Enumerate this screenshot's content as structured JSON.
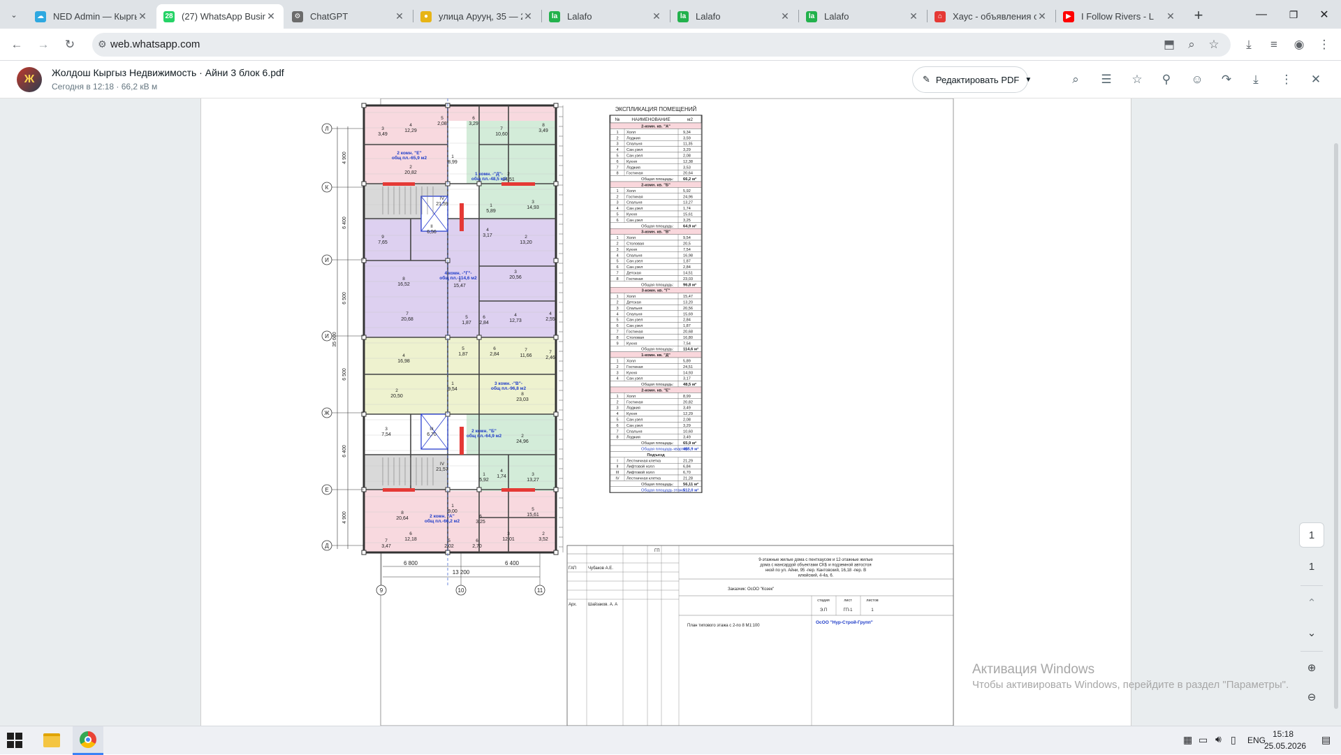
{
  "browser": {
    "tabs": [
      {
        "title": "NED Admin — Кыргы",
        "color": "#2ea8e0",
        "glyph": "☁",
        "active": false
      },
      {
        "title": "(27) WhatsApp Busin",
        "color": "#25d366",
        "glyph": "28",
        "active": true
      },
      {
        "title": "ChatGPT",
        "color": "#6b6b6b",
        "glyph": "⚙",
        "active": false
      },
      {
        "title": "улица Арууң, 35 — 2",
        "color": "#e7b416",
        "glyph": "●",
        "active": false
      },
      {
        "title": "Lalafo",
        "color": "#22b14c",
        "glyph": "la",
        "active": false
      },
      {
        "title": "Lalafo",
        "color": "#22b14c",
        "glyph": "la",
        "active": false
      },
      {
        "title": "Lalafo",
        "color": "#22b14c",
        "glyph": "la",
        "active": false
      },
      {
        "title": "Хаус - объявления о",
        "color": "#e53935",
        "glyph": "⌂",
        "active": false
      },
      {
        "title": "I Follow Rivers - L",
        "color": "#ff0000",
        "glyph": "▶",
        "active": false
      }
    ],
    "url": "web.whatsapp.com"
  },
  "document": {
    "name": "Жолдош Кыргыз Недвижимость · Айни 3 блок 6.pdf",
    "meta": "Сегодня в 12:18 · 66,2 кВ м",
    "edit_label": "Редактировать PDF"
  },
  "plan": {
    "axes_rows": [
      "Л",
      "К",
      "И",
      "И",
      "Ж",
      "Е",
      "Д"
    ],
    "axes_cols": [
      "9",
      "10",
      "11"
    ],
    "dims_left": [
      "4 900",
      "6 400",
      "6 500",
      "6 500",
      "6 400",
      "4 900"
    ],
    "dim_total": "35 600",
    "dims_bottom": [
      "6 800",
      "6 400"
    ],
    "dim_bottom_total": "13 200",
    "labels": [
      "2 комн. \"Е\" общ пл.-65,9 м2",
      "1 комн. -\"Д\"- общ пл.-48,5 м2",
      "4 комн. -\"Г\"- общ пл.-114,6 м2",
      "3 комн. -\"В\"- общ пл.-96,8 м2",
      "2 комн. \"Б\" общ пл.-64,9 м2",
      "2 комн. \"А\" общ пл.-66,2 м2"
    ]
  },
  "explication": {
    "title": "ЭКСПЛИКАЦИЯ ПОМЕЩЕНИЙ",
    "headers": [
      "№",
      "НАИМЕНОВАНИЕ",
      "м2"
    ],
    "groups": [
      {
        "name": "2-комн. кв. \"А\"",
        "rows": [
          [
            "1",
            "Холл",
            "9,34"
          ],
          [
            "2",
            "Лоджия",
            "3,59"
          ],
          [
            "3",
            "Спальня",
            "11,35"
          ],
          [
            "4",
            "Сан.узел",
            "3,29"
          ],
          [
            "5",
            "Сан.узел",
            "2,08"
          ],
          [
            "6",
            "Кухня",
            "12,38"
          ],
          [
            "7",
            "Лоджия",
            "3,53"
          ],
          [
            "8",
            "Гостиная",
            "20,64"
          ]
        ],
        "total": "66,2 м²"
      },
      {
        "name": "2-комн. кв. \"Б\"",
        "rows": [
          [
            "1",
            "Холл",
            "5,92"
          ],
          [
            "2",
            "Гостиная",
            "24,96"
          ],
          [
            "3",
            "Спальня",
            "13,27"
          ],
          [
            "4",
            "Сан.узел",
            "1,74"
          ],
          [
            "5",
            "Кухня",
            "15,61"
          ],
          [
            "6",
            "Сан.узел",
            "3,25"
          ]
        ],
        "total": "64,9 м²"
      },
      {
        "name": "3-комн. кв. \"В\"",
        "rows": [
          [
            "1",
            "Холл",
            "9,54"
          ],
          [
            "2",
            "Столовая",
            "20,5"
          ],
          [
            "3",
            "Кухня",
            "7,54"
          ],
          [
            "4",
            "Спальня",
            "16,98"
          ],
          [
            "5",
            "Сан.узел",
            "1,87"
          ],
          [
            "6",
            "Сан.узел",
            "2,84"
          ],
          [
            "7",
            "Детская",
            "14,51"
          ],
          [
            "8",
            "Гостиная",
            "23,03"
          ]
        ],
        "total": "96,8 м²"
      },
      {
        "name": "3-комн. кв. \"Г\"",
        "rows": [
          [
            "1",
            "Холл",
            "15,47"
          ],
          [
            "2",
            "Детская",
            "13,20"
          ],
          [
            "3",
            "Спальня",
            "20,56"
          ],
          [
            "4",
            "Спальня",
            "15,69"
          ],
          [
            "5",
            "Сан.узел",
            "2,84"
          ],
          [
            "6",
            "Сан.узел",
            "1,87"
          ],
          [
            "7",
            "Гостиная",
            "20,68"
          ],
          [
            "8",
            "Столовая",
            "16,80"
          ],
          [
            "9",
            "Кухня",
            "7,54"
          ]
        ],
        "total": "114,6 м²"
      },
      {
        "name": "1-комн. кв. \"Д\"",
        "rows": [
          [
            "1",
            "Холл",
            "5,89"
          ],
          [
            "2",
            "Гостиная",
            "24,51"
          ],
          [
            "3",
            "Кухня",
            "14,93"
          ],
          [
            "4",
            "Сан.узел",
            "3,17"
          ]
        ],
        "total": "48,5 м²"
      },
      {
        "name": "2-комн. кв. \"Е\"",
        "rows": [
          [
            "1",
            "Холл",
            "8,99"
          ],
          [
            "2",
            "Гостиная",
            "20,82"
          ],
          [
            "3",
            "Лоджия",
            "3,49"
          ],
          [
            "4",
            "Кухня",
            "12,29"
          ],
          [
            "5",
            "Сан.узел",
            "2,08"
          ],
          [
            "6",
            "Сан.узел",
            "3,29"
          ],
          [
            "7",
            "Спальня",
            "10,60"
          ],
          [
            "8",
            "Лоджия",
            "3,49"
          ]
        ],
        "total": "65,9 м²"
      }
    ],
    "total_label": "Общая площадь:",
    "apartments_total_label": "Общая площадь квартир:",
    "apartments_total": "455,9 м²",
    "entrance_title": "Подъезд",
    "entrance_rows": [
      [
        "I",
        "Лестничная клетка",
        "21,29"
      ],
      [
        "II",
        "Лифтовой холл",
        "6,84"
      ],
      [
        "III",
        "Лифтовой холл",
        "6,70"
      ],
      [
        "IV",
        "Лестничная клетка",
        "21,28"
      ]
    ],
    "entrance_total": "56,11 м²",
    "floor_total_label": "Общая площадь этажа:",
    "floor_total": "512,0 м²"
  },
  "stamp": {
    "gp": "ГП",
    "gap_label": "ГАП",
    "gap_name": "Чубаков А.Е.",
    "arch_label": "Арх.",
    "arch_name": "Шайзаков. А. А",
    "project": "9-этажные жилые дома с пентхаусом и 12-этажные жилые дома с мансардой объектами СКБ и подземной автостоянкой по ул. Айни, 95 -пер. Кантовский, 16,18 -пер. Вилюйский, 4-4а, 6.",
    "customer": "Заказчик: ОсОО \"Козек\"",
    "stage_h": "стадия",
    "sheet_h": "лист",
    "sheets_h": "листов",
    "stage": "Э.П",
    "sheet": "ГП-1",
    "sheets": "1",
    "sheet_title": "План типового этажа с 2-по 8 М1:100",
    "company": "ОсОО \"Нур-Строй-Групп\""
  },
  "watermark": {
    "title": "Активация Windows",
    "text": "Чтобы активировать Windows, перейдите в раздел \"Параметры\"."
  },
  "side": {
    "page_current": "1",
    "page_total": "1"
  },
  "taskbar": {
    "lang": "ENG",
    "time": "15:18",
    "date": "25.05.2026"
  }
}
